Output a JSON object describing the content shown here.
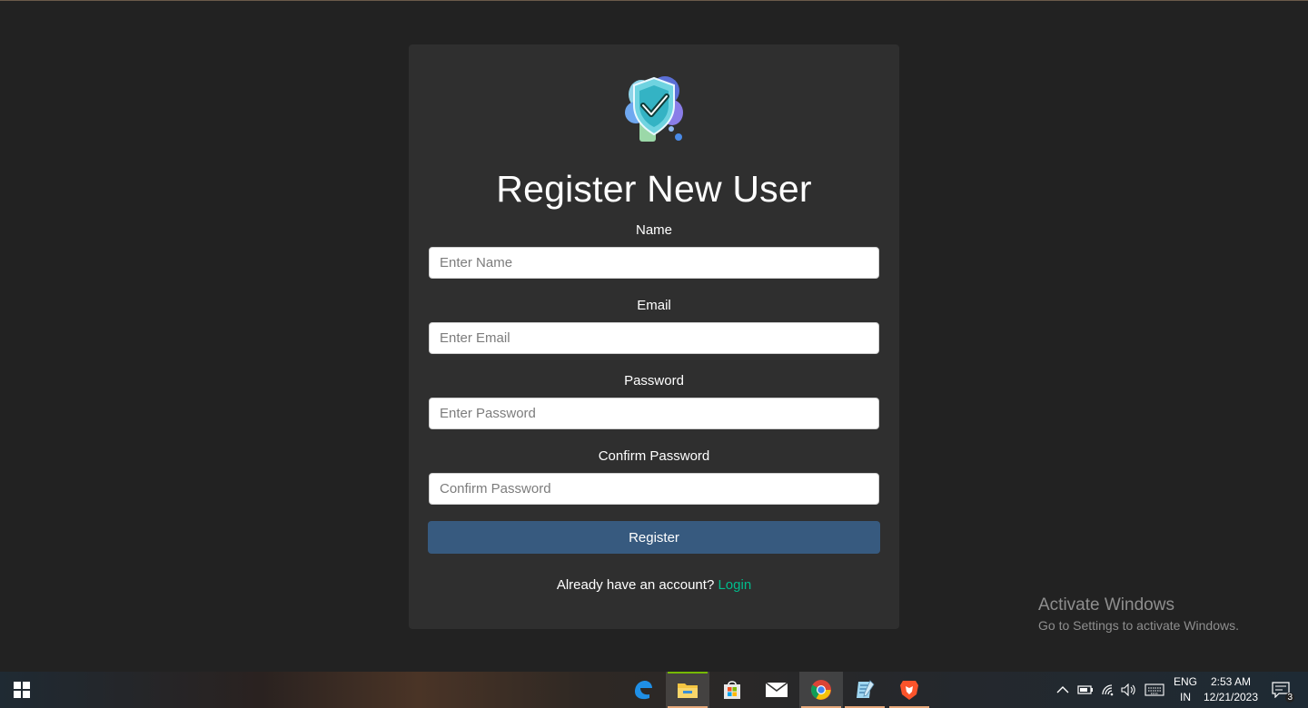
{
  "form": {
    "title": "Register New User",
    "fields": [
      {
        "label": "Name",
        "placeholder": "Enter Name",
        "value": ""
      },
      {
        "label": "Email",
        "placeholder": "Enter Email",
        "value": ""
      },
      {
        "label": "Password",
        "placeholder": "Enter Password",
        "value": ""
      },
      {
        "label": "Confirm Password",
        "placeholder": "Confirm Password",
        "value": ""
      }
    ],
    "submit_label": "Register",
    "footer_text": "Already have an account?",
    "footer_link": "Login"
  },
  "watermark": {
    "line1": "Activate Windows",
    "line2": "Go to Settings to activate Windows."
  },
  "taskbar": {
    "apps": [
      "start-icon",
      "edge-icon",
      "file-explorer-icon",
      "store-icon",
      "mail-icon",
      "chrome-icon",
      "notepad-icon",
      "brave-icon"
    ],
    "lang_line1": "ENG",
    "lang_line2": "IN",
    "time": "2:53 AM",
    "date": "12/21/2023",
    "notification_count": "3"
  },
  "colors": {
    "page_background": "#222222",
    "card_background": "#2f2f2f",
    "button": "#375a7f",
    "link": "#00bc8c"
  }
}
